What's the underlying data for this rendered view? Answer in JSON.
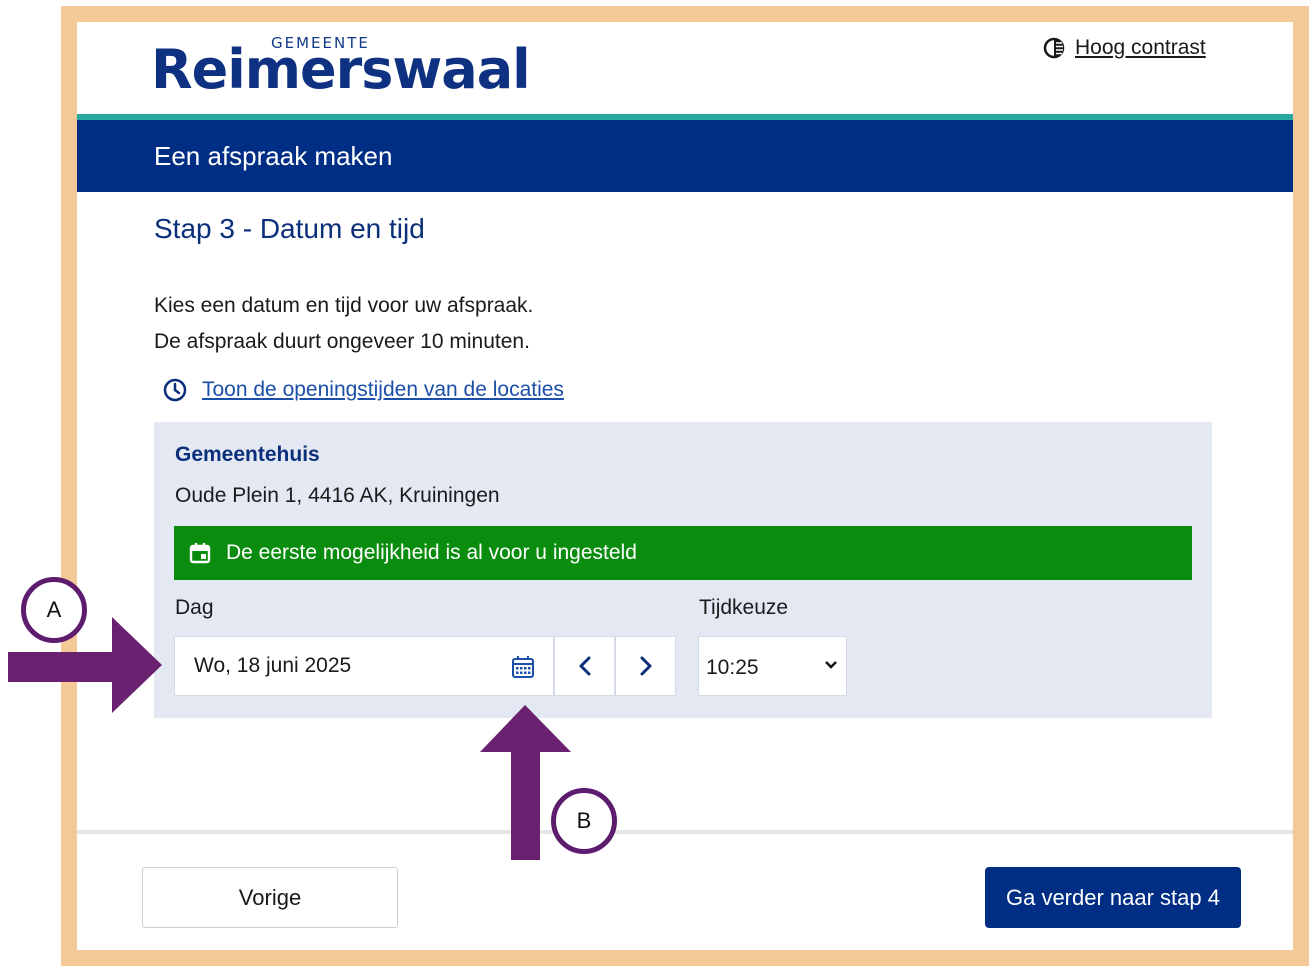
{
  "header": {
    "logo_small": "GEMEENTE",
    "logo_big": "Reimerswaal",
    "contrast_label": "Hoog contrast",
    "icon": "contrast-icon"
  },
  "banner": {
    "title": "Een afspraak maken"
  },
  "main": {
    "step_title": "Stap 3 - Datum en tijd",
    "intro_line1": "Kies een datum en tijd voor uw afspraak.",
    "intro_line2": "De afspraak duurt ongeveer 10 minuten.",
    "hours_link": "Toon de openingstijden van de locaties",
    "hours_icon": "clock-icon"
  },
  "location": {
    "name": "Gemeentehuis",
    "address": "Oude Plein 1, 4416 AK, Kruiningen",
    "notice": "De eerste mogelijkheid is al voor u ingesteld",
    "notice_icon": "calendar-icon",
    "day_label": "Dag",
    "day_value": "Wo, 18 juni 2025",
    "time_label": "Tijdkeuze",
    "time_value": "10:25"
  },
  "footer": {
    "prev_label": "Vorige",
    "next_label": "Ga verder naar stap 4"
  },
  "annotations": {
    "marker_a": "A",
    "marker_b": "B"
  },
  "colors": {
    "frame": "#f3c998",
    "brand_blue": "#002e85",
    "accent_teal": "#2aa7a0",
    "notice_green": "#0a8c0e",
    "arrow_purple": "#6a2170"
  }
}
